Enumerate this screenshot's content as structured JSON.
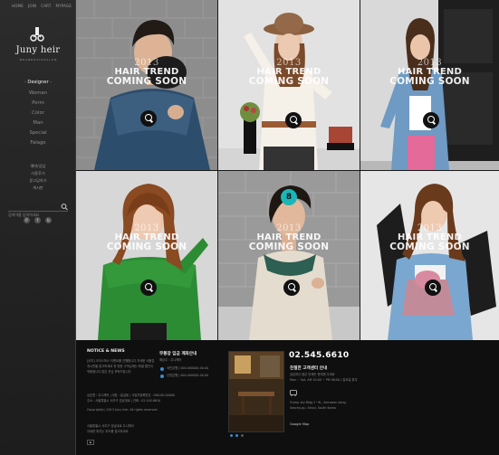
{
  "topnav": [
    "HOME",
    "JOIN",
    "CART",
    "MYPAGE"
  ],
  "brand": {
    "name": "Juny heir",
    "tagline": "B R A N D  H A I R  S A L O N"
  },
  "menu_head": "· Designer ·",
  "menu": [
    "Woman",
    "Perm",
    "Color",
    "Man",
    "Special",
    "Falage"
  ],
  "sub_menu": [
    "예약/상담",
    "사용후기",
    "묻고답하기",
    "게시판"
  ],
  "search": {
    "placeholder": "검색어를 입력하세요"
  },
  "social": [
    "P",
    "f",
    "b"
  ],
  "tiles": [
    {
      "year": "2013",
      "line1": "HAIR TREND",
      "line2": "COMING SOON"
    },
    {
      "year": "2013",
      "line1": "HAIR TREND",
      "line2": "COMING SOON"
    },
    {
      "year": "2013",
      "line1": "HAIR TREND",
      "line2": "COMING SOON"
    },
    {
      "year": "2013",
      "line1": "HAIR TREND",
      "line2": "COMING SOON"
    },
    {
      "year": "2013",
      "line1": "HAIR TREND",
      "line2": "COMING SOON"
    },
    {
      "year": "2013",
      "line1": "HAIR TREND",
      "line2": "COMING SOON"
    }
  ],
  "badge_number": "8",
  "footer": {
    "notice_title": "NOTICE & NEWS",
    "notice_lines": [
      "[공지] 크리스마스 이벤트를 진행합니다 자세한 내용은",
      "게시판을 참고하세요 첫 방문 고객님께는 특별 할인이",
      "적용됩니다 많은 관심 부탁드립니다"
    ],
    "info_lines": [
      "상호명 : 주니헤어 | 대표 : 홍길동 | 사업자등록번호 : 000-00-00000",
      "주소 : 서울특별시 서초구 강남대로 | 전화 : 02.545.6610"
    ],
    "copyright": "Copyright(c) 2013 Juny heir. All rights reserved.",
    "address_lines": [
      "서울특별시 서초구 강남대로 주니헤어",
      "자세한 위치는 지도를 참고하세요"
    ],
    "bank_title": "무통장 입금 계좌안내",
    "bank_sub": "예금주 : 주니헤어",
    "bank_lines": [
      "국민은행 | 000-000000-00-00",
      "신한은행 | 000-000000-00-00"
    ],
    "phone": "02.545.6610",
    "cs_title": "친절한 고객센터 안내",
    "cs_lines": [
      "궁금하신 점은 언제든 문의해 주세요",
      "Mon ~ Sat, AM 10:00 ~ PM 08:00 / 일요일 휴무"
    ],
    "addr_en": [
      "Trump sky Bldg 2~9L, Samseon dong,",
      "Seocho-gu, Seoul, South Korea"
    ],
    "gmap": "Google Map"
  }
}
